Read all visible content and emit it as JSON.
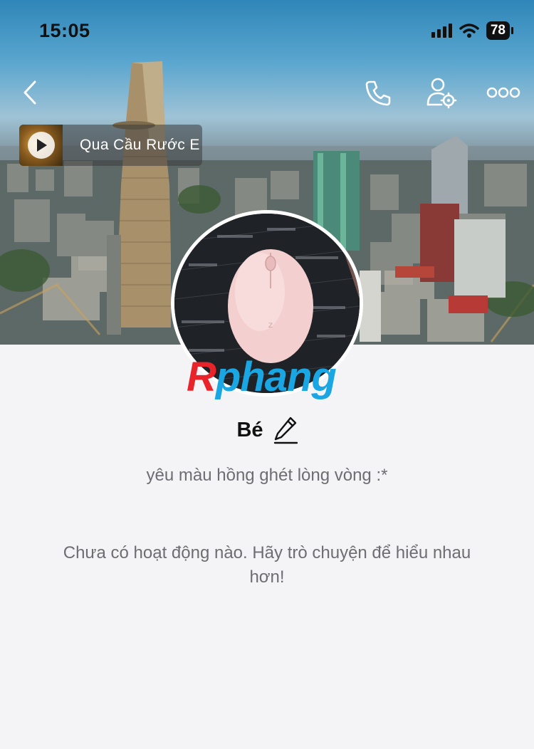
{
  "status_bar": {
    "time": "15:05",
    "battery": "78"
  },
  "nav": {
    "back_icon": "chevron-left-icon",
    "call_icon": "phone-icon",
    "settings_icon": "user-settings-icon",
    "more_icon": "more-icon"
  },
  "music": {
    "title": "Qua Cầu Rước E",
    "icon": "play-icon"
  },
  "watermark": {
    "part1": "R",
    "part2": "phang"
  },
  "profile": {
    "name": "Bé",
    "bio": "yêu màu hồng ghét lòng vòng :*"
  },
  "activity": {
    "empty_message": "Chưa có hoạt động nào. Hãy trò chuyện để hiểu nhau hơn!"
  },
  "colors": {
    "page_bg": "#f4f4f7",
    "secondary_text": "#6d6d72",
    "watermark_red": "#e8232a",
    "watermark_blue": "#19a6e3"
  }
}
